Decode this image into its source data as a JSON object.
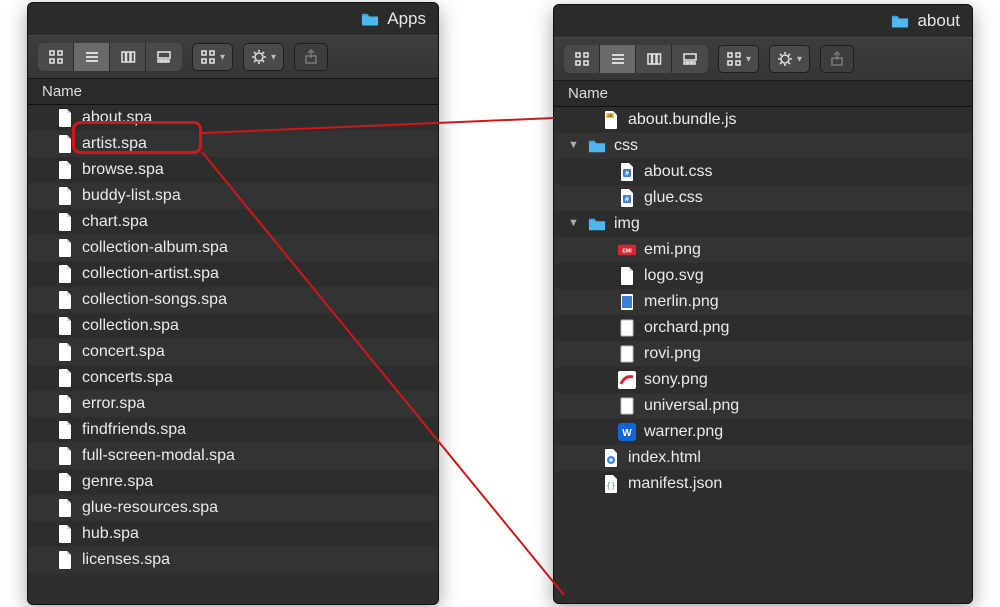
{
  "leftWindow": {
    "title": "Apps",
    "columnHeader": "Name",
    "items": [
      {
        "name": "about.spa",
        "icon": "doc"
      },
      {
        "name": "artist.spa",
        "icon": "doc"
      },
      {
        "name": "browse.spa",
        "icon": "doc"
      },
      {
        "name": "buddy-list.spa",
        "icon": "doc"
      },
      {
        "name": "chart.spa",
        "icon": "doc"
      },
      {
        "name": "collection-album.spa",
        "icon": "doc"
      },
      {
        "name": "collection-artist.spa",
        "icon": "doc"
      },
      {
        "name": "collection-songs.spa",
        "icon": "doc"
      },
      {
        "name": "collection.spa",
        "icon": "doc"
      },
      {
        "name": "concert.spa",
        "icon": "doc"
      },
      {
        "name": "concerts.spa",
        "icon": "doc"
      },
      {
        "name": "error.spa",
        "icon": "doc"
      },
      {
        "name": "findfriends.spa",
        "icon": "doc"
      },
      {
        "name": "full-screen-modal.spa",
        "icon": "doc"
      },
      {
        "name": "genre.spa",
        "icon": "doc"
      },
      {
        "name": "glue-resources.spa",
        "icon": "doc"
      },
      {
        "name": "hub.spa",
        "icon": "doc"
      },
      {
        "name": "licenses.spa",
        "icon": "doc"
      }
    ]
  },
  "rightWindow": {
    "title": "about",
    "columnHeader": "Name",
    "items": [
      {
        "name": "about.bundle.js",
        "icon": "js",
        "depth": 1
      },
      {
        "name": "css",
        "icon": "folder",
        "depth": 0,
        "expanded": true
      },
      {
        "name": "about.css",
        "icon": "hash",
        "depth": 2
      },
      {
        "name": "glue.css",
        "icon": "hash",
        "depth": 2
      },
      {
        "name": "img",
        "icon": "folder",
        "depth": 0,
        "expanded": true
      },
      {
        "name": "emi.png",
        "icon": "emi",
        "depth": 2
      },
      {
        "name": "logo.svg",
        "icon": "doc",
        "depth": 2
      },
      {
        "name": "merlin.png",
        "icon": "img-blue",
        "depth": 2
      },
      {
        "name": "orchard.png",
        "icon": "img-white",
        "depth": 2
      },
      {
        "name": "rovi.png",
        "icon": "img-white",
        "depth": 2
      },
      {
        "name": "sony.png",
        "icon": "sony",
        "depth": 2
      },
      {
        "name": "universal.png",
        "icon": "img-white",
        "depth": 2
      },
      {
        "name": "warner.png",
        "icon": "warner",
        "depth": 2
      },
      {
        "name": "index.html",
        "icon": "chrome",
        "depth": 1
      },
      {
        "name": "manifest.json",
        "icon": "json",
        "depth": 1
      }
    ]
  }
}
